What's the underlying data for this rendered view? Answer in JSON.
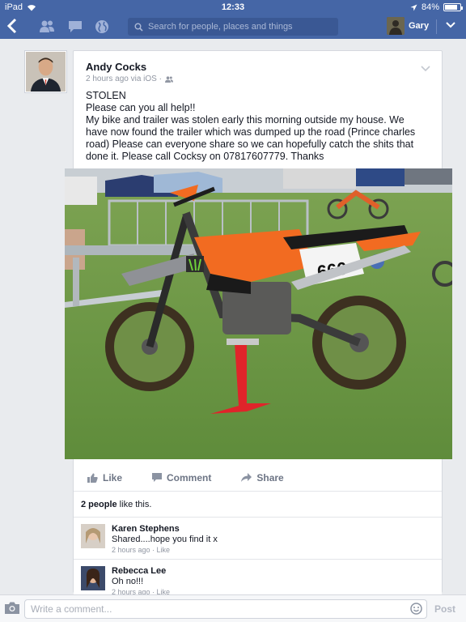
{
  "status_bar": {
    "device": "iPad",
    "time": "12:33",
    "battery": "84%",
    "battery_level": 0.84
  },
  "nav": {
    "search_placeholder": "Search for people, places and things",
    "user_name": "Gary"
  },
  "post": {
    "author": "Andy Cocks",
    "meta": "2 hours ago via iOS ·",
    "lines": [
      "STOLEN",
      "Please can you all help!!",
      "My bike and trailer was stolen early this morning outside my house. We",
      "have now found the trailer which was dumped up the road (Prince charles",
      "road) Please can everyone share so we can hopefully catch the shits that",
      "done it. Please call Cocksy on 07817607779. Thanks"
    ],
    "bike_number": "666"
  },
  "actions": {
    "like": "Like",
    "comment": "Comment",
    "share": "Share"
  },
  "likes": {
    "count": "2 people",
    "suffix": " like this."
  },
  "comments": [
    {
      "name": "Karen Stephens",
      "text": "Shared....hope you find it x",
      "meta": "2 hours ago · Like"
    },
    {
      "name": "Rebecca Lee",
      "text": "Oh no!!!",
      "meta": "2 hours ago · Like"
    }
  ],
  "composer": {
    "placeholder": "Write a comment...",
    "post_label": "Post"
  },
  "colors": {
    "brand": "#4566a6",
    "accent_orange": "#f26b21"
  }
}
